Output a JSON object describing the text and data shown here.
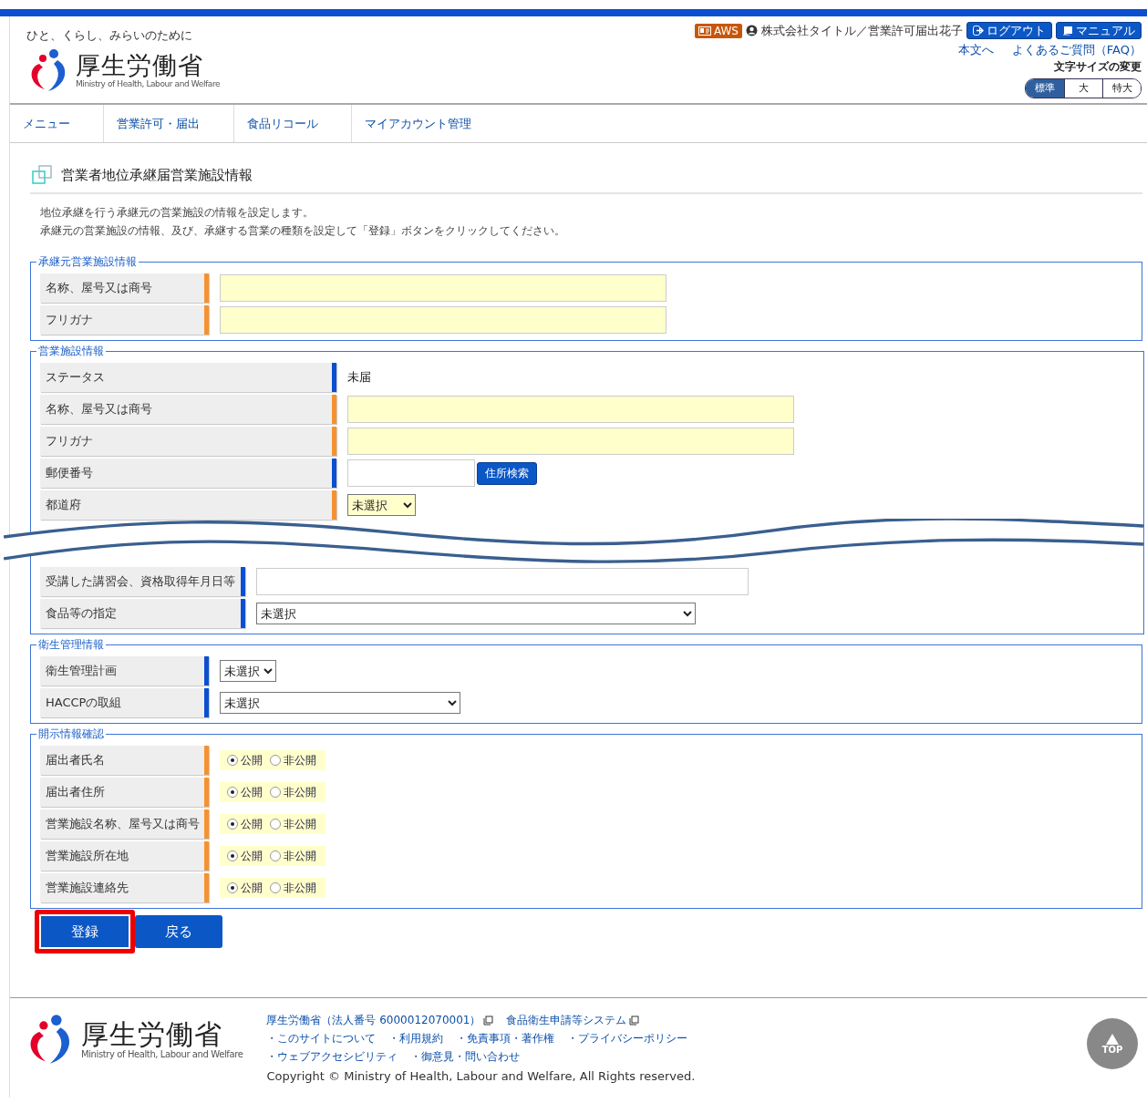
{
  "header": {
    "tagline": "ひと、くらし、みらいのために",
    "logo_title": "厚生労働省",
    "logo_subtitle": "Ministry of Health, Labour and Welfare",
    "env_badge": "AWS",
    "user": "株式会社タイトル／営業許可届出花子",
    "logout": "ログアウト",
    "manual": "マニュアル",
    "links": [
      "本文へ",
      "よくあるご質問（FAQ）"
    ],
    "font_size_label": "文字サイズの変更",
    "font_sizes": [
      {
        "label": "標準",
        "selected": true
      },
      {
        "label": "大",
        "selected": false
      },
      {
        "label": "特大",
        "selected": false
      }
    ]
  },
  "nav": [
    "メニュー",
    "営業許可・届出",
    "食品リコール",
    "マイアカウント管理"
  ],
  "page_title": "営業者地位承継届営業施設情報",
  "description": [
    "地位承継を行う承継元の営業施設の情報を設定します。",
    "承継元の営業施設の情報、及び、承継する営業の種類を設定して「登録」ボタンをクリックしてください。"
  ],
  "sections": [
    {
      "legend": "承継元営業施設情報",
      "rows": [
        {
          "label": "名称、屋号又は商号",
          "required": true,
          "kind": "input"
        },
        {
          "label": "フリガナ",
          "required": true,
          "kind": "input"
        }
      ]
    },
    {
      "legend": "営業施設情報",
      "rows": [
        {
          "label": "ステータス",
          "required": false,
          "kind": "text",
          "value": "未届"
        },
        {
          "label": "名称、屋号又は商号",
          "required": true,
          "kind": "input"
        },
        {
          "label": "フリガナ",
          "required": true,
          "kind": "input"
        },
        {
          "label": "郵便番号",
          "required": false,
          "kind": "input_button",
          "button": "住所検索"
        },
        {
          "label": "都道府",
          "required": true,
          "kind": "select",
          "value": "未選択"
        }
      ],
      "rows_after_break": [
        {
          "label": "受講した講習会、資格取得年月日等",
          "required": false,
          "kind": "input"
        },
        {
          "label": "食品等の指定",
          "required": false,
          "kind": "select",
          "value": "未選択"
        }
      ]
    },
    {
      "legend": "衛生管理情報",
      "rows": [
        {
          "label": "衛生管理計画",
          "required": false,
          "kind": "select",
          "value": "未選択"
        },
        {
          "label": "HACCPの取組",
          "required": false,
          "kind": "select",
          "value": "未選択"
        }
      ]
    },
    {
      "legend": "開示情報確認",
      "rows": [
        {
          "label": "届出者氏名",
          "required": true,
          "kind": "radio",
          "options": [
            {
              "label": "公開",
              "selected": true
            },
            {
              "label": "非公開",
              "selected": false
            }
          ]
        },
        {
          "label": "届出者住所",
          "required": true,
          "kind": "radio",
          "options": [
            {
              "label": "公開",
              "selected": true
            },
            {
              "label": "非公開",
              "selected": false
            }
          ]
        },
        {
          "label": "営業施設名称、屋号又は商号",
          "required": true,
          "kind": "radio",
          "options": [
            {
              "label": "公開",
              "selected": true
            },
            {
              "label": "非公開",
              "selected": false
            }
          ]
        },
        {
          "label": "営業施設所在地",
          "required": true,
          "kind": "radio",
          "options": [
            {
              "label": "公開",
              "selected": true
            },
            {
              "label": "非公開",
              "selected": false
            }
          ]
        },
        {
          "label": "営業施設連絡先",
          "required": true,
          "kind": "radio",
          "options": [
            {
              "label": "公開",
              "selected": true
            },
            {
              "label": "非公開",
              "selected": false
            }
          ]
        }
      ]
    }
  ],
  "buttons": [
    {
      "label": "登録",
      "highlighted": true
    },
    {
      "label": "戻る",
      "highlighted": false
    }
  ],
  "footer": {
    "logo_title": "厚生労働省",
    "logo_subtitle": "Ministry of Health, Labour and Welfare",
    "external_links": [
      "厚生労働省（法人番号 6000012070001）",
      "食品衛生申請等システム"
    ],
    "links": [
      [
        "・このサイトについて",
        "・利用規約",
        "・免責事項・著作権",
        "・プライバシーポリシー"
      ],
      [
        "・ウェブアクセシビリティ",
        "・御意見・問い合わせ"
      ]
    ],
    "copyright": "Copyright © Ministry of Health, Labour and Welfare, All Rights reserved.",
    "top": "TOP"
  }
}
